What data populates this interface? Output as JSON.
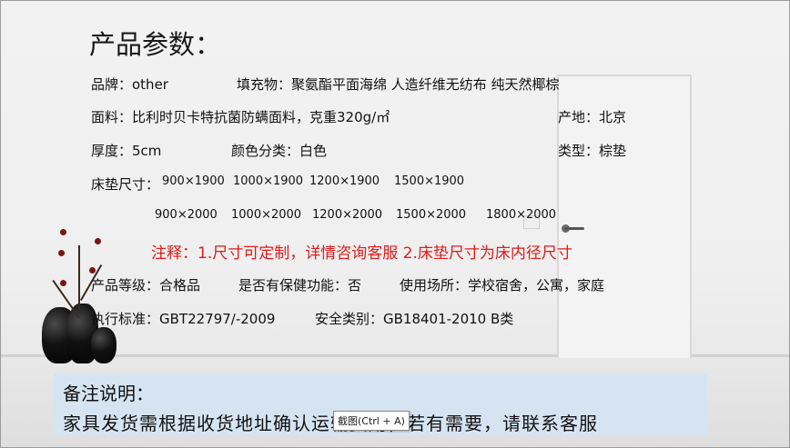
{
  "title": "产品参数：",
  "rows": {
    "brand": "品牌：other",
    "filling": "填充物：聚氨酯平面海绵 人造纤维无纺布  纯天然椰棕",
    "fabric": "面料：比利时贝卡特抗菌防螨面料，克重320g/㎡",
    "origin": "产地：北京",
    "thickness": "厚度：5cm",
    "color": "颜色分类：白色",
    "type": "类型：棕垫",
    "size_label": "床垫尺寸：",
    "sizes_row1": [
      "900×1900",
      "1000×1900",
      "1200×1900",
      "1500×1900"
    ],
    "sizes_row2": [
      "900×2000",
      "1000×2000",
      "1200×2000",
      "1500×2000",
      "1800×2000"
    ],
    "note": "注释：1.尺寸可定制，详情咨询客服   2.床垫尺寸为床内径尺寸",
    "grade": "产品等级：合格品",
    "health": "是否有保健功能：否",
    "usage": "使用场所：学校宿舍，公寓，家庭",
    "standard": "执行标准：GBT22797/-2009",
    "safety": "安全类别：GB18401-2010 B类"
  },
  "remark": {
    "heading": "备注说明：",
    "body": "家具发货需根据收货地址确认运输费用，若有需要，请联系客服"
  },
  "tooltip": "截图(Ctrl + A)",
  "colors": {
    "note_red": "#e01b1b",
    "remark_bg": "#d6e4f2"
  }
}
